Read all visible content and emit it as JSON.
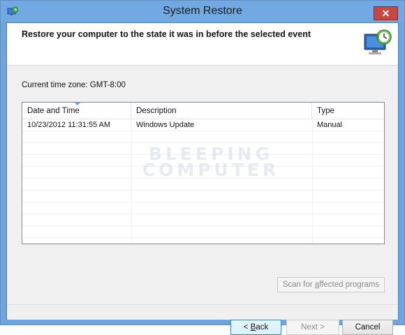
{
  "window": {
    "title": "System Restore",
    "close_symbol": "✕",
    "app_icon": "system-restore-icon"
  },
  "header": {
    "text": "Restore your computer to the state it was in before the selected event",
    "icon": "system-restore-monitor-icon"
  },
  "timezone_label": "Current time zone: GMT-8:00",
  "table": {
    "columns": [
      "Date and Time",
      "Description",
      "Type"
    ],
    "rows": [
      {
        "date": "10/23/2012 11:31:55 AM",
        "description": "Windows Update",
        "type": "Manual"
      }
    ]
  },
  "watermark": {
    "line1": "BLEEPING",
    "line2": "COMPUTER"
  },
  "buttons": {
    "scan_pre": "Scan for ",
    "scan_key": "a",
    "scan_post": "ffected programs",
    "back_pre": "< ",
    "back_key": "B",
    "back_post": "ack",
    "next": "Next >",
    "cancel": "Cancel"
  },
  "colors": {
    "titlebar": "#72a9e2",
    "close_button": "#c74842"
  }
}
